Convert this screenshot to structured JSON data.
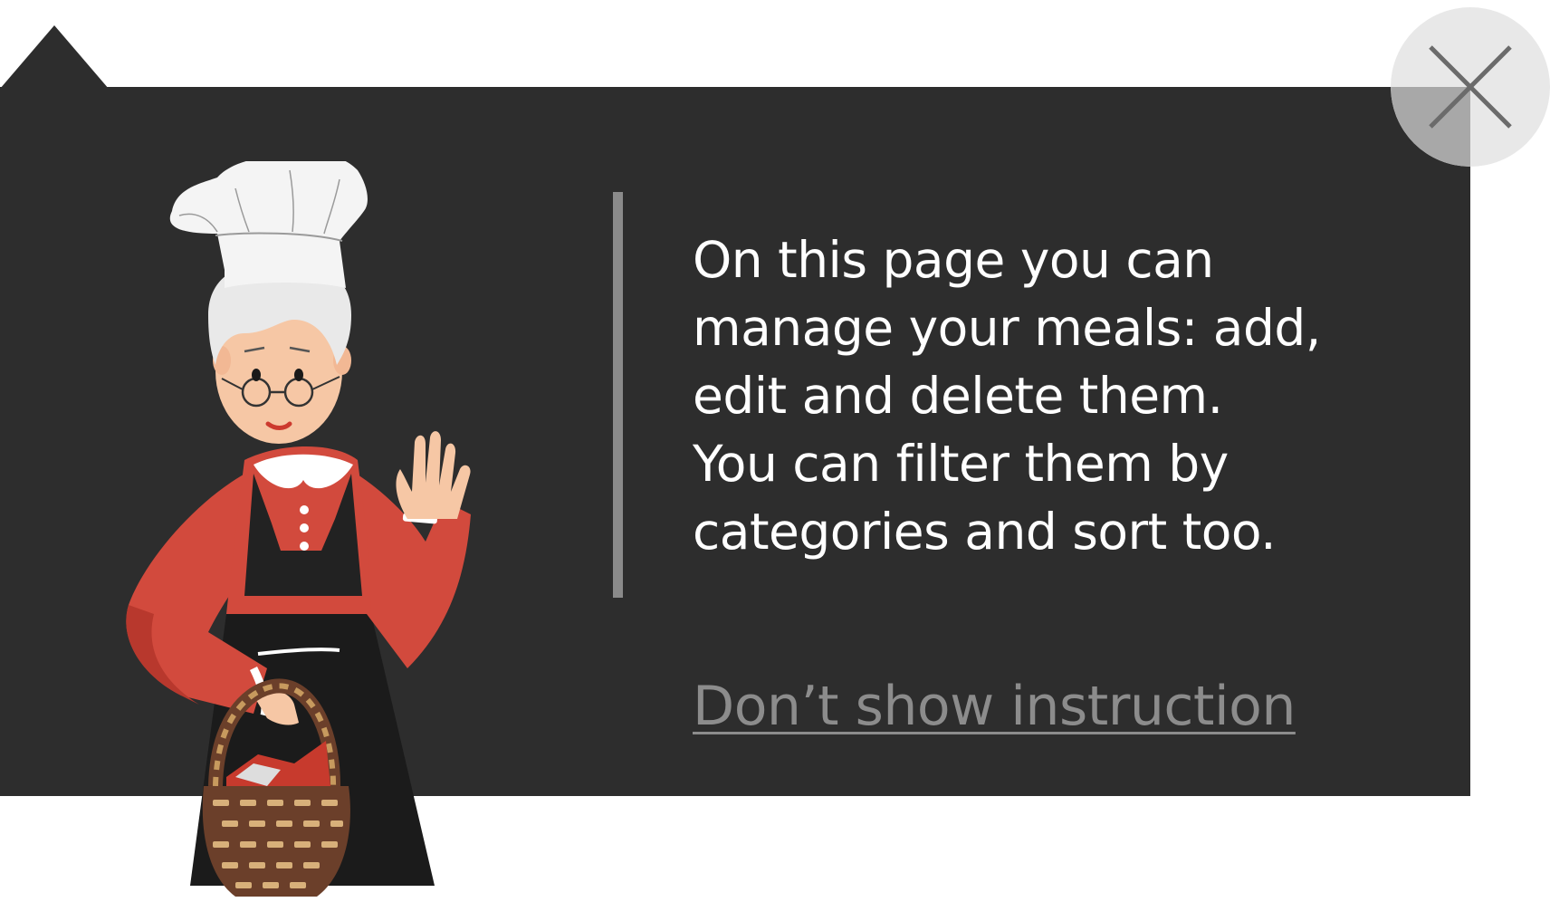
{
  "dialog": {
    "message": "On this page you can\nmanage your meals: add,\nedit and delete them.\nYou can filter them by\ncategories and sort too.",
    "dont_show_label": "Don’t show instruction"
  },
  "icons": {
    "close": "close-icon",
    "mascot": "chef-grandma-illustration"
  },
  "colors": {
    "panel_background": "#2d2d2d",
    "message_text": "#ffffff",
    "link_text": "#8c8c8c",
    "divider": "#8a8a8a",
    "close_button": "#e8e8e8",
    "close_glyph": "#6b6b6b"
  }
}
